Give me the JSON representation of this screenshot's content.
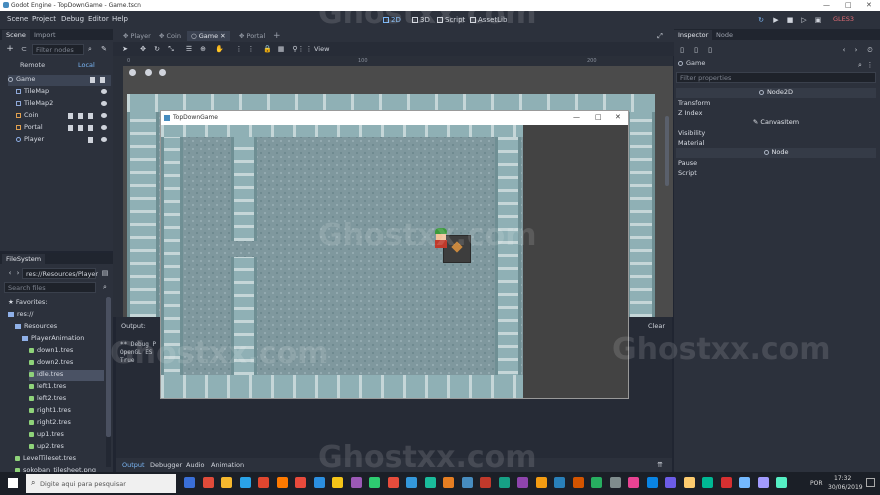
{
  "window": {
    "title": "Godot Engine - TopDownGame - Game.tscn"
  },
  "menu": [
    "Scene",
    "Project",
    "Debug",
    "Editor",
    "Help"
  ],
  "workspaces": [
    {
      "label": "2D",
      "active": true
    },
    {
      "label": "3D",
      "active": false
    },
    {
      "label": "Script",
      "active": false
    },
    {
      "label": "AssetLib",
      "active": false
    }
  ],
  "renderer": "GLES3",
  "scene_panel": {
    "tabs": [
      "Scene",
      "Import"
    ],
    "filter_placeholder": "Filter nodes",
    "remote": "Remote",
    "local": "Local",
    "nodes": [
      {
        "label": "Game",
        "selected": true
      },
      {
        "label": "TileMap"
      },
      {
        "label": "TileMap2"
      },
      {
        "label": "Coin"
      },
      {
        "label": "Portal"
      },
      {
        "label": "Player"
      }
    ]
  },
  "filesystem": {
    "tab": "FileSystem",
    "path": "res://Resources/Player",
    "search_placeholder": "Search files",
    "items": [
      {
        "label": "Favorites:",
        "indent": 0,
        "kind": "star"
      },
      {
        "label": "res://",
        "indent": 0,
        "kind": "folder"
      },
      {
        "label": "Resources",
        "indent": 1,
        "kind": "folder"
      },
      {
        "label": "PlayerAnimation",
        "indent": 2,
        "kind": "folder"
      },
      {
        "label": "down1.tres",
        "indent": 3,
        "kind": "res"
      },
      {
        "label": "down2.tres",
        "indent": 3,
        "kind": "res"
      },
      {
        "label": "idle.tres",
        "indent": 3,
        "kind": "res",
        "selected": true
      },
      {
        "label": "left1.tres",
        "indent": 3,
        "kind": "res"
      },
      {
        "label": "left2.tres",
        "indent": 3,
        "kind": "res"
      },
      {
        "label": "right1.tres",
        "indent": 3,
        "kind": "res"
      },
      {
        "label": "right2.tres",
        "indent": 3,
        "kind": "res"
      },
      {
        "label": "up1.tres",
        "indent": 3,
        "kind": "res"
      },
      {
        "label": "up2.tres",
        "indent": 3,
        "kind": "res"
      },
      {
        "label": "LevelTileset.tres",
        "indent": 1,
        "kind": "res"
      },
      {
        "label": "sokoban_tilesheet.png",
        "indent": 1,
        "kind": "res"
      }
    ]
  },
  "scene_tabs": [
    "Player",
    "Coin",
    "Game",
    "Portal"
  ],
  "active_scene_tab": "Game",
  "view_menu": "View",
  "ruler": [
    "0",
    "100",
    "200"
  ],
  "game_window": {
    "title": "TopDownGame"
  },
  "output": {
    "title": "Output:",
    "clear": "Clear",
    "lines": [
      "** Debug P",
      "OpenGL ES",
      "True"
    ],
    "tabs": [
      "Output",
      "Debugger",
      "Audio",
      "Animation"
    ]
  },
  "inspector": {
    "tabs": [
      "Inspector",
      "Node"
    ],
    "object": "Game",
    "filter_placeholder": "Filter properties",
    "sections": {
      "node2d": "Node2D",
      "canvas": "CanvasItem",
      "node": "Node"
    },
    "props_node2d": [
      "Transform",
      "Z Index"
    ],
    "props_canvas": [
      "Visibility",
      "Material"
    ],
    "props_node": [
      "Pause",
      "Script"
    ]
  },
  "taskbar": {
    "search_placeholder": "Digite aqui para pesquisar",
    "lang": "POR",
    "time": "17:32",
    "date": "30/06/2019"
  },
  "watermark": "Ghostxx.com"
}
